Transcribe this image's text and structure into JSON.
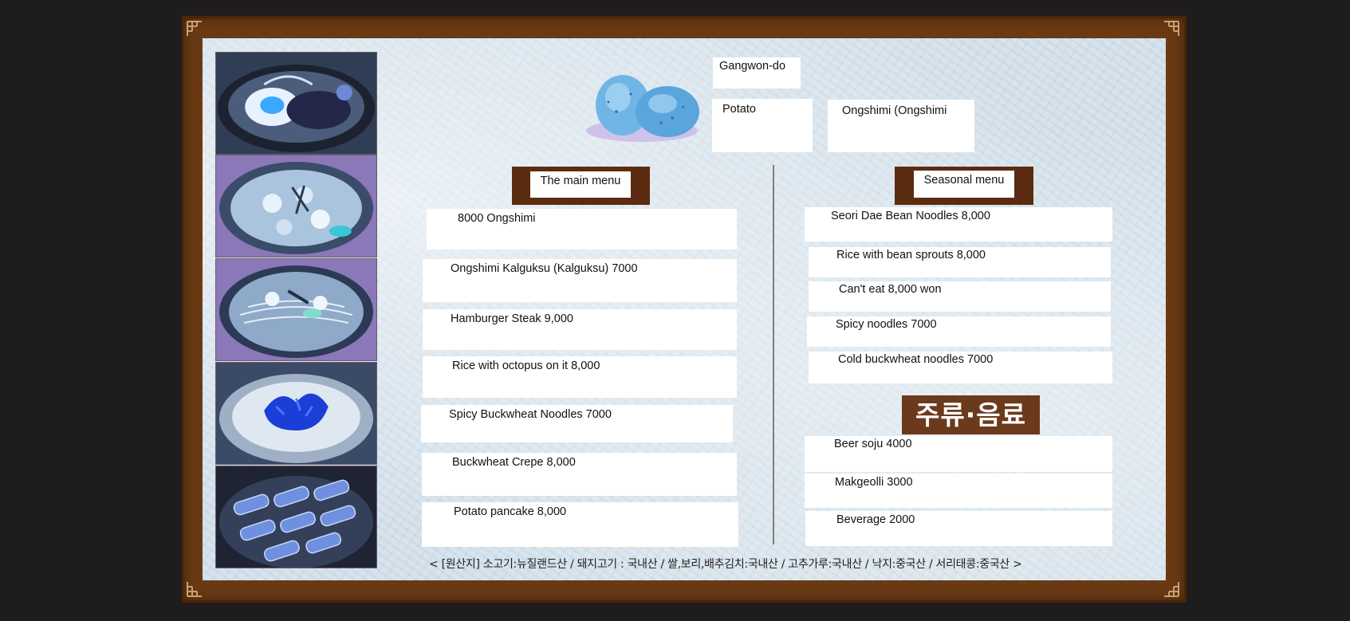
{
  "header": {
    "region": "Gangwon-do",
    "potato": "Potato",
    "ongshimi": "Ongshimi (Ongshimi"
  },
  "main_menu": {
    "title": "The main menu",
    "items": [
      "8000 Ongshimi",
      "Ongshimi Kalguksu (Kalguksu) 7000",
      "Hamburger Steak 9,000",
      "Rice with octopus on it 8,000",
      "Spicy Buckwheat Noodles 7000",
      "Buckwheat Crepe 8,000",
      "Potato pancake 8,000"
    ]
  },
  "seasonal_menu": {
    "title": "Seasonal menu",
    "items": [
      "Seori Dae Bean Noodles 8,000",
      "Rice with bean sprouts 8,000",
      "Can't eat 8,000 won",
      "Spicy noodles 7000",
      "Cold buckwheat noodles 7000"
    ]
  },
  "drinks": {
    "title": "주류·음료",
    "items": [
      "Beer soju 4000",
      "Makgeolli 3000",
      "Beverage 2000"
    ]
  },
  "origin_note": "< [원산지]  소고기:뉴질랜드산 / 돼지고기 : 국내산 / 쌀,보리,배추김치:국내산 / 고추가루:국내산 / 낙지:중국산 / 서리태콩:중국산 >",
  "photos": [
    "fried-egg-steak-photo",
    "ongshimi-soup-photo",
    "kalguksu-photo",
    "octopus-rice-photo",
    "buckwheat-crepe-photo"
  ],
  "colors": {
    "frame": "#6a3a14",
    "tag": "#5b2c10",
    "paper": "#d3e0ea"
  }
}
